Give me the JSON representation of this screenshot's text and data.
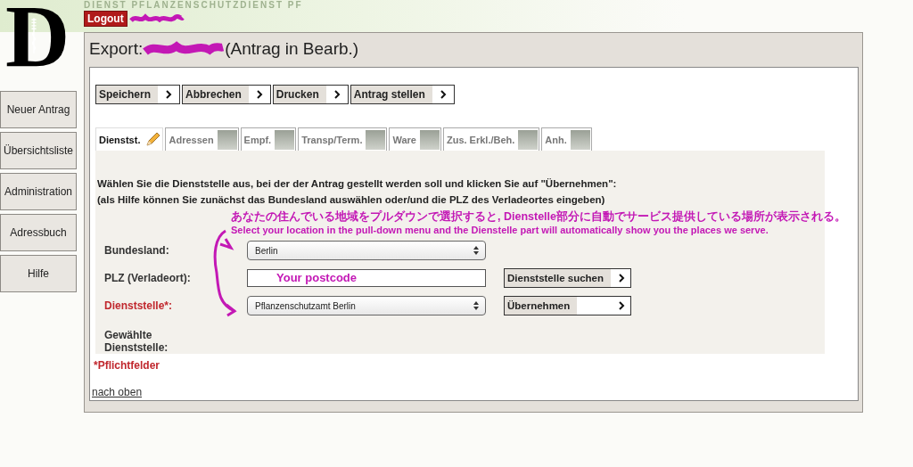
{
  "header": {
    "pattern_text": "DIENST PFLANZENSCHUTZDIENST PF",
    "logo_letter": "D",
    "logout": "Logout"
  },
  "sidebar": {
    "items": [
      "Neuer Antrag",
      "Übersichtsliste",
      "Administration",
      "Adressbuch",
      "Hilfe"
    ]
  },
  "panel": {
    "title_prefix": "Export:",
    "title_suffix": "(Antrag in Bearb.)"
  },
  "toolbar": [
    "Speichern",
    "Abbrechen",
    "Drucken",
    "Antrag stellen"
  ],
  "tabs": [
    {
      "label": "Dienstst.",
      "selected": true
    },
    {
      "label": "Adressen",
      "selected": false
    },
    {
      "label": "Empf.",
      "selected": false
    },
    {
      "label": "Transp/Term.",
      "selected": false
    },
    {
      "label": "Ware",
      "selected": false
    },
    {
      "label": "Zus. Erkl./Beh.",
      "selected": false
    },
    {
      "label": "Anh.",
      "selected": false
    }
  ],
  "instructions": [
    "Wählen Sie die Dienststelle aus, bei der der Antrag gestellt werden soll und klicken Sie auf \"Übernehmen\":",
    "(als Hilfe können Sie zunächst das Bundesland auswählen oder/und die PLZ des Verladeortes eingeben)"
  ],
  "annotation": [
    "あなたの住んでいる地域をプルダウンで選択すると, Dienstelle部分に自動でサービス提供している場所が表示される。",
    "Select your location in the pull-down menu and the Dienstelle part will automatically show you the places we serve."
  ],
  "form": {
    "bundesland": {
      "label": "Bundesland:",
      "value": "Berlin"
    },
    "plz": {
      "label": "PLZ (Verladeort):",
      "value": "Your postcode",
      "button": "Dienststelle suchen"
    },
    "dienststelle": {
      "label": "Dienststelle*:",
      "required": true,
      "value": "Pflanzenschutzamt Berlin",
      "button": "Übernehmen"
    },
    "gewaehlt": {
      "label": "Gewählte Dienststelle:"
    }
  },
  "required_note": "*Pflichtfelder",
  "top_link": "nach oben"
}
